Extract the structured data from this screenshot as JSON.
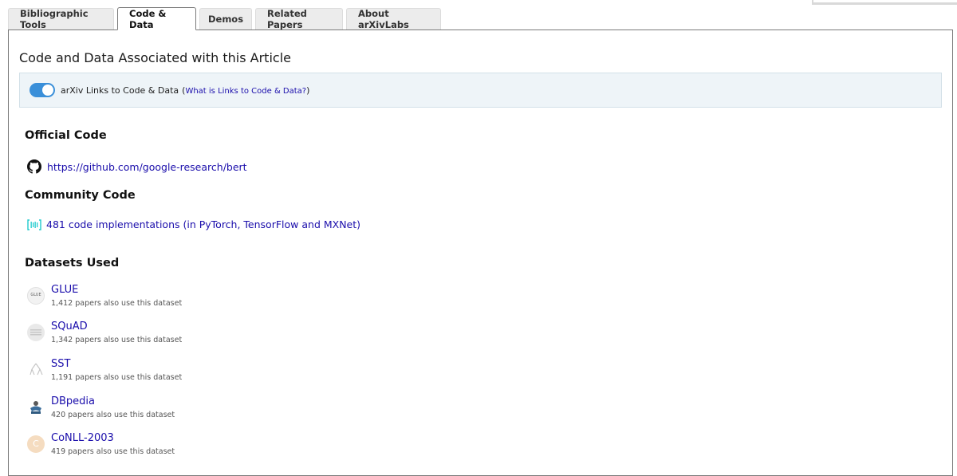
{
  "tabs": [
    {
      "label": "Bibliographic Tools",
      "active": false
    },
    {
      "label": "Code & Data",
      "active": true
    },
    {
      "label": "Demos",
      "active": false
    },
    {
      "label": "Related Papers",
      "active": false
    },
    {
      "label": "About arXivLabs",
      "active": false
    }
  ],
  "panel": {
    "title": "Code and Data Associated with this Article",
    "toggle": {
      "label": "arXiv Links to Code & Data",
      "paren_open": "(",
      "link": "What is Links to Code & Data?",
      "paren_close": ")",
      "enabled": true
    }
  },
  "official_code": {
    "heading": "Official Code",
    "link": "https://github.com/google-research/bert",
    "icon": "github-icon"
  },
  "community_code": {
    "heading": "Community Code",
    "link": "481 code implementations (in PyTorch, TensorFlow and MXNet)",
    "icon": "papers-with-code-icon"
  },
  "datasets": {
    "heading": "Datasets Used",
    "items": [
      {
        "name": "GLUE",
        "count": "1,412 papers also use this dataset",
        "thumb_text": "GLUE"
      },
      {
        "name": "SQuAD",
        "count": "1,342 papers also use this dataset",
        "thumb_text": ""
      },
      {
        "name": "SST",
        "count": "1,191 papers also use this dataset",
        "thumb_text": ""
      },
      {
        "name": "DBpedia",
        "count": "420 papers also use this dataset",
        "thumb_text": ""
      },
      {
        "name": "CoNLL-2003",
        "count": "419 papers also use this dataset",
        "thumb_text": "C"
      }
    ]
  },
  "colors": {
    "link": "#1a0dab",
    "toggle_on": "#3a8fd9",
    "toggle_bar_bg": "#eef4f8",
    "pwc_icon": "#21cbce"
  }
}
